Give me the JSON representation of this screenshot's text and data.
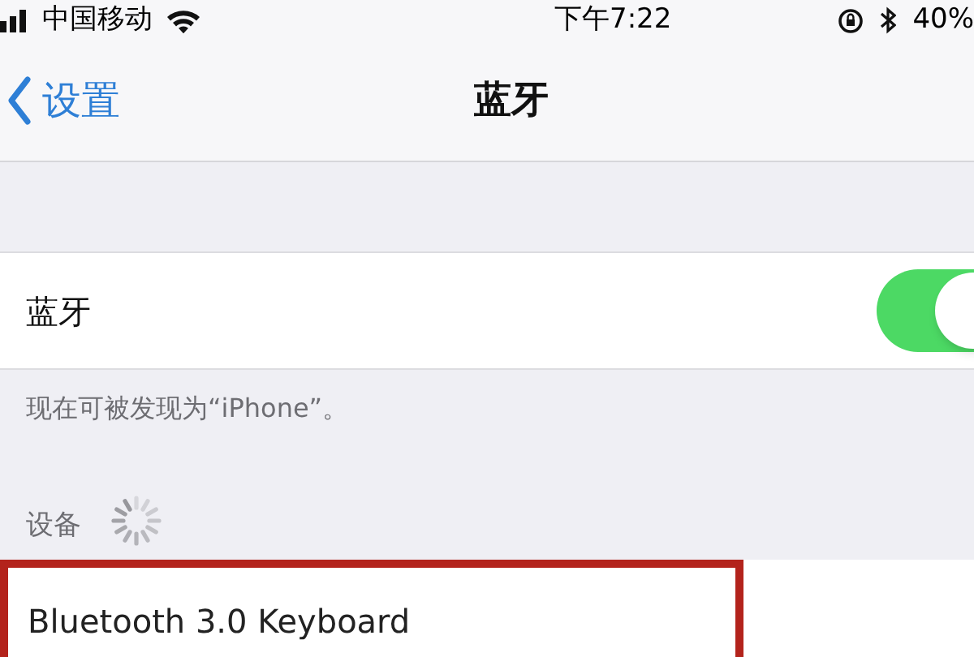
{
  "status_bar": {
    "carrier": "中国移动",
    "time": "下午7:22",
    "battery": "40%"
  },
  "nav": {
    "back_label": "设置",
    "title": "蓝牙"
  },
  "bluetooth_row": {
    "label": "蓝牙",
    "on": true
  },
  "footer": "现在可被发现为“iPhone”。",
  "devices": {
    "header": "设备",
    "searching": true,
    "items": [
      {
        "name": "Bluetooth 3.0 Keyboard",
        "highlighted": true
      }
    ]
  }
}
